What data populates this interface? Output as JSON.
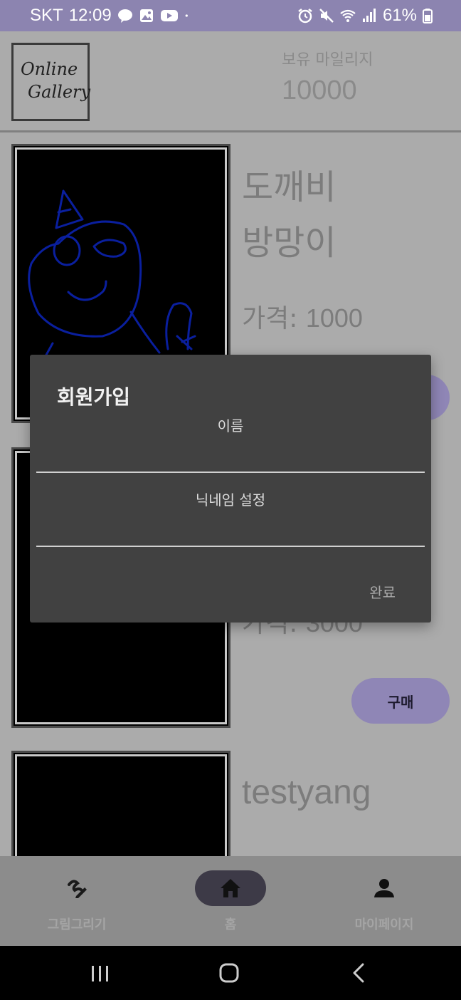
{
  "status_bar": {
    "carrier": "SKT",
    "time": "12:09",
    "battery": "61%",
    "icons_left": [
      "talk-icon",
      "gallery-icon",
      "youtube-icon",
      "dot-icon"
    ],
    "icons_right": [
      "alarm-icon",
      "mute-icon",
      "wifi-icon",
      "signal-icon",
      "battery-icon"
    ]
  },
  "header": {
    "logo_line1": "Online",
    "logo_line2": "Gallery",
    "mileage_label": "보유 마일리지",
    "mileage_value": "10000"
  },
  "products": [
    {
      "title_line1": "도깨비",
      "title_line2": "방망이",
      "price_label": "가격:",
      "price": "1000"
    },
    {
      "price_label": "가격:",
      "price": "3000",
      "buy_label": "구매"
    },
    {
      "title_line1": "testyang"
    }
  ],
  "dialog": {
    "title": "회원가입",
    "name_label": "이름",
    "nickname_label": "닉네임 설정",
    "name_value": "",
    "nickname_value": "",
    "done_label": "완료"
  },
  "bottom_nav": {
    "items": [
      {
        "label": "그림그리기",
        "icon": "draw-icon"
      },
      {
        "label": "홈",
        "icon": "home-icon",
        "active": true
      },
      {
        "label": "마이페이지",
        "icon": "person-icon"
      }
    ]
  },
  "colors": {
    "status_bar": "#8c84b0",
    "accent": "#8f86b6",
    "dialog_bg": "#414141",
    "doodle": "#0a1f9e"
  }
}
